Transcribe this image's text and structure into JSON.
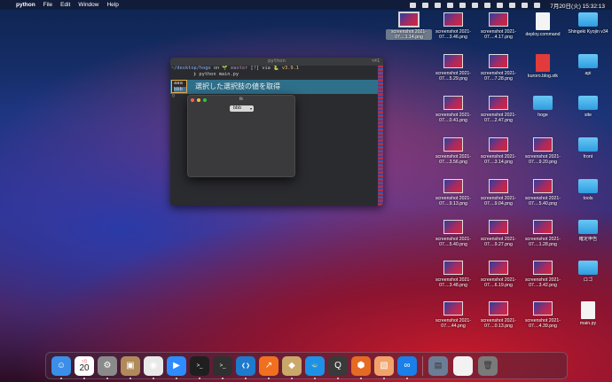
{
  "menubar": {
    "app_name": "python",
    "menus": [
      "File",
      "Edit",
      "Window",
      "Help"
    ],
    "clock": "7月20日(火)  15:32:13"
  },
  "terminal": {
    "title": "python",
    "shortcut": "⌥⌘1",
    "prompt_path": "~/desktop/hoge",
    "prompt_on": " on ",
    "prompt_branch": "🌱 master",
    "prompt_status": " [!] via ",
    "prompt_version": "🐍 v3.9.1",
    "command": "❯ python main.py",
    "banner_text": "選択した選択肢の値を取得",
    "listbox_options": [
      "aaa",
      "bbb"
    ],
    "cursor_line": "▯"
  },
  "tk_window": {
    "title": "tk",
    "select_value": "bbb",
    "select_caret": "▾"
  },
  "desktop": {
    "items": [
      {
        "kind": "shot",
        "label": "screenshot 2021-07....1.14.png",
        "selected": true
      },
      {
        "kind": "shot",
        "label": "screenshot 2021-07....3.46.png"
      },
      {
        "kind": "shot",
        "label": "screenshot 2021-07....4.17.png"
      },
      {
        "kind": "doc",
        "label": "deploy.command"
      },
      {
        "kind": "folder",
        "label": "Shingeki Kyojin v34"
      },
      {
        "kind": "shot",
        "label": "screenshot 2021-07....5.29.png"
      },
      {
        "kind": "shot",
        "label": "screenshot 2021-07....7.28.png"
      },
      {
        "kind": "docred",
        "label": "kuroro.blog.stk"
      },
      {
        "kind": "folder",
        "label": "api"
      },
      {
        "kind": "shot",
        "label": "screenshot 2021-07....0.41.png"
      },
      {
        "kind": "shot",
        "label": "screenshot 2021-07....2.47.png"
      },
      {
        "kind": "folder",
        "label": "hoge"
      },
      {
        "kind": "folder",
        "label": "site"
      },
      {
        "kind": "shot",
        "label": "screenshot 2021-07....3.56.png"
      },
      {
        "kind": "shot",
        "label": "screenshot 2021-07....3.14.png"
      },
      {
        "kind": "shot",
        "label": "screenshot 2021-07....9.20.png"
      },
      {
        "kind": "folder",
        "label": "front"
      },
      {
        "kind": "shot",
        "label": "screenshot 2021-07....9.13.png"
      },
      {
        "kind": "shot",
        "label": "screenshot 2021-07....9.04.png"
      },
      {
        "kind": "shot",
        "label": "screenshot 2021-07....5.40.png"
      },
      {
        "kind": "folder",
        "label": "tools"
      },
      {
        "kind": "shot",
        "label": "screenshot 2021-07....5.40.png"
      },
      {
        "kind": "shot",
        "label": "screenshot 2021-07....9.27.png"
      },
      {
        "kind": "shot",
        "label": "screenshot 2021-07....1.28.png"
      },
      {
        "kind": "folder",
        "label": "確定申告"
      },
      {
        "kind": "shot",
        "label": "screenshot 2021-07....3.48.png"
      },
      {
        "kind": "shot",
        "label": "screenshot 2021-07....6.19.png"
      },
      {
        "kind": "shot",
        "label": "screenshot 2021-07....3.42.png"
      },
      {
        "kind": "folder",
        "label": "ロゴ"
      },
      {
        "kind": "shot",
        "label": "screenshot 2021-07....44.png"
      },
      {
        "kind": "shot",
        "label": "screenshot 2021-07....0.13.png"
      },
      {
        "kind": "shot",
        "label": "screenshot 2021-07....4.39.png"
      },
      {
        "kind": "doc",
        "label": "main.py"
      }
    ]
  },
  "dock": {
    "calendar_month": "7月",
    "calendar_day": "20",
    "apps": [
      {
        "name": "finder-icon",
        "color": "#3b8fe8",
        "glyph": "☺"
      },
      {
        "name": "calendar-icon",
        "color": "#ffffff",
        "glyph": ""
      },
      {
        "name": "system-preferences-icon",
        "color": "#8a8a8a",
        "glyph": "⚙"
      },
      {
        "name": "contacts-icon",
        "color": "#b08a5a",
        "glyph": "▣"
      },
      {
        "name": "chrome-icon",
        "color": "#e9e9e9",
        "glyph": "◉"
      },
      {
        "name": "zoom-icon",
        "color": "#2d8cff",
        "glyph": "▶"
      },
      {
        "name": "terminal-icon",
        "color": "#1f1f1f",
        "glyph": ">_"
      },
      {
        "name": "terminal-alt-icon",
        "color": "#303030",
        "glyph": ">_"
      },
      {
        "name": "vscode-icon",
        "color": "#1e7acc",
        "glyph": "❮❯"
      },
      {
        "name": "activity-chart-icon",
        "color": "#f0701f",
        "glyph": "↗"
      },
      {
        "name": "package-icon",
        "color": "#c9a86a",
        "glyph": "◆"
      },
      {
        "name": "docker-icon",
        "color": "#1d91e6",
        "glyph": "🐳"
      },
      {
        "name": "quicktime-icon",
        "color": "#3a3a3a",
        "glyph": "Q"
      },
      {
        "name": "sourcetree-icon",
        "color": "#e56a24",
        "glyph": "⬢"
      },
      {
        "name": "sketch-icon",
        "color": "#f1a26b",
        "glyph": "▧"
      },
      {
        "name": "infinity-icon",
        "color": "#1a7fe8",
        "glyph": "∞"
      }
    ],
    "recent": [
      {
        "name": "preview-icon",
        "color": "#6c7d96",
        "glyph": "▤"
      },
      {
        "name": "document-icon",
        "color": "#f2f2f2",
        "glyph": ""
      },
      {
        "name": "trash-icon",
        "color": "#7a7a7a",
        "glyph": "🗑"
      }
    ]
  }
}
